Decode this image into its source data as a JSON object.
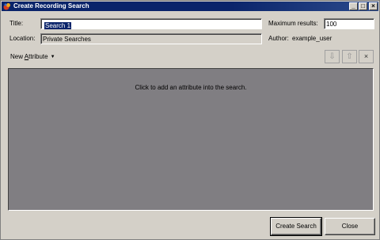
{
  "window": {
    "title": "Create Recording Search",
    "minimize": "_",
    "maximize": "□",
    "close": "×"
  },
  "form": {
    "title_label": "Title:",
    "title_value": "Search 1",
    "max_results_label": "Maximum results:",
    "max_results_value": "100",
    "location_label": "Location:",
    "location_value": "Private Searches",
    "author_label": "Author:",
    "author_value": "example_user"
  },
  "toolbar": {
    "new_attribute_prefix": "New ",
    "new_attribute_underlined": "A",
    "new_attribute_suffix": "ttribute",
    "move_down": "⇩",
    "move_up": "⇧",
    "remove": "×"
  },
  "panel": {
    "hint": "Click to add an attribute into the search."
  },
  "buttons": {
    "create": "Create Search",
    "close": "Close"
  },
  "colors": {
    "titlebar": "#0a246a",
    "panel": "#807e82",
    "face": "#d4d0c8"
  }
}
